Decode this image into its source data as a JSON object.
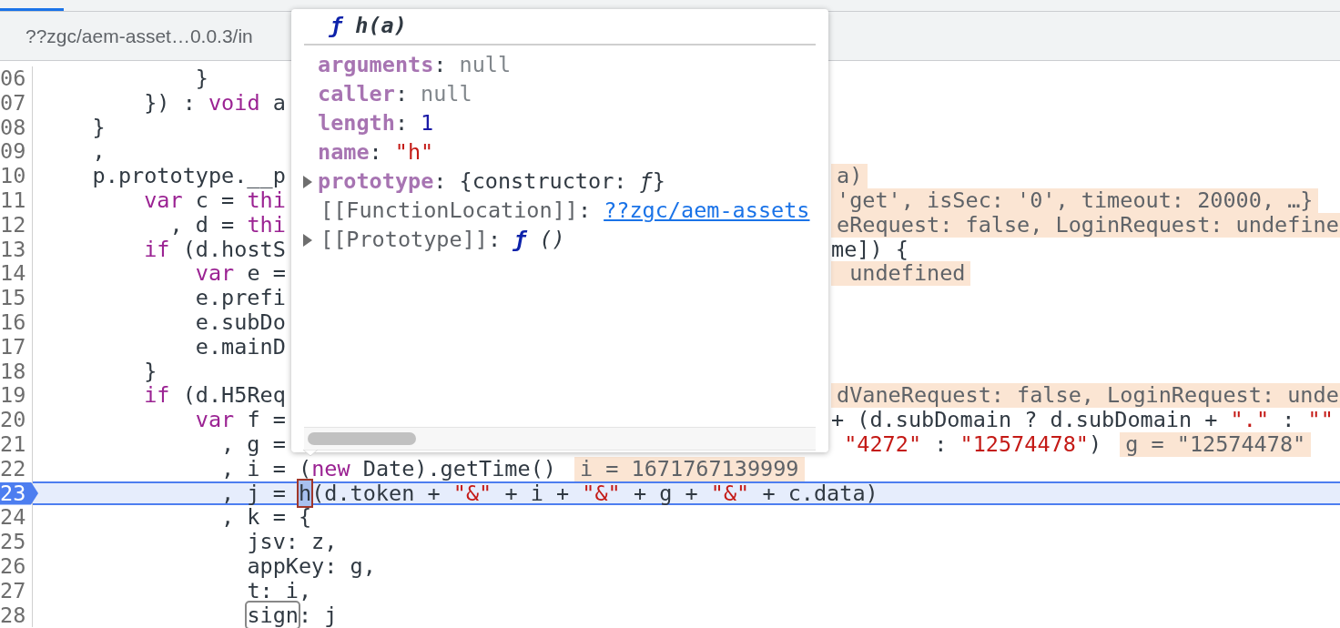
{
  "file_tab": {
    "label": "??zgc/aem-asset…0.0.3/in"
  },
  "lines": [
    {
      "number": "06",
      "current": false,
      "left": [
        {
          "text": "            }",
          "kind": "plain"
        }
      ]
    },
    {
      "number": "07",
      "current": false,
      "left": [
        {
          "text": "        }) : ",
          "kind": "plain"
        },
        {
          "text": "void",
          "kind": "keyword"
        },
        {
          "text": " a",
          "kind": "plain"
        }
      ]
    },
    {
      "number": "08",
      "current": false,
      "left": [
        {
          "text": "    }",
          "kind": "plain"
        }
      ]
    },
    {
      "number": "09",
      "current": false,
      "left": [
        {
          "text": "    ,",
          "kind": "plain"
        }
      ]
    },
    {
      "number": "10",
      "current": false,
      "left": [
        {
          "text": "    p.prototype.__p",
          "kind": "plain"
        }
      ],
      "right": [
        {
          "text": "a)",
          "kind": "value"
        }
      ]
    },
    {
      "number": "11",
      "current": false,
      "left": [
        {
          "text": "        var",
          "kind": "keyword"
        },
        {
          "text": " c = ",
          "kind": "plain"
        },
        {
          "text": "thi",
          "kind": "keyword"
        }
      ],
      "right": [
        {
          "text": "'get', isSec: '0', timeout: 20000, …}",
          "kind": "value"
        }
      ]
    },
    {
      "number": "12",
      "current": false,
      "left": [
        {
          "text": "          , d = ",
          "kind": "plain"
        },
        {
          "text": "thi",
          "kind": "keyword"
        }
      ],
      "right": [
        {
          "text": "eRequest: false, LoginRequest: undefine",
          "kind": "value"
        }
      ]
    },
    {
      "number": "13",
      "current": false,
      "left": [
        {
          "text": "        if",
          "kind": "keyword"
        },
        {
          "text": " (d.hostS",
          "kind": "plain"
        }
      ],
      "right": [
        {
          "text": "me]) {",
          "kind": "plain"
        }
      ]
    },
    {
      "number": "14",
      "current": false,
      "left": [
        {
          "text": "            var",
          "kind": "keyword"
        },
        {
          "text": " e =",
          "kind": "plain"
        }
      ],
      "right": [
        {
          "text": " undefined",
          "kind": "value"
        }
      ]
    },
    {
      "number": "15",
      "current": false,
      "left": [
        {
          "text": "            e.prefi",
          "kind": "plain"
        }
      ]
    },
    {
      "number": "16",
      "current": false,
      "left": [
        {
          "text": "            e.subDo",
          "kind": "plain"
        }
      ]
    },
    {
      "number": "17",
      "current": false,
      "left": [
        {
          "text": "            e.mainD",
          "kind": "plain"
        }
      ]
    },
    {
      "number": "18",
      "current": false,
      "left": [
        {
          "text": "        }",
          "kind": "plain"
        }
      ]
    },
    {
      "number": "19",
      "current": false,
      "left": [
        {
          "text": "        if",
          "kind": "keyword"
        },
        {
          "text": " (d.H5Req",
          "kind": "plain"
        }
      ],
      "right": [
        {
          "text": "dVaneRequest: false, LoginRequest: unde",
          "kind": "value"
        }
      ]
    },
    {
      "number": "20",
      "current": false,
      "left": [
        {
          "text": "            var",
          "kind": "keyword"
        },
        {
          "text": " f =",
          "kind": "plain"
        }
      ],
      "right": [
        {
          "text": "+ (d.subDomain ? d.subDomain + ",
          "kind": "plain"
        },
        {
          "text": "\".\"",
          "kind": "string"
        },
        {
          "text": " : ",
          "kind": "plain"
        },
        {
          "text": "\"\"",
          "kind": "string"
        }
      ]
    },
    {
      "number": "21",
      "current": false,
      "left": [
        {
          "text": "              , g =",
          "kind": "plain"
        }
      ],
      "right": [
        {
          "text": " \"4272\"",
          "kind": "string"
        },
        {
          "text": " : ",
          "kind": "plain"
        },
        {
          "text": "\"12574478\"",
          "kind": "string"
        },
        {
          "text": ")",
          "kind": "plain"
        },
        {
          "text": "g = \"12574478\"",
          "kind": "value"
        }
      ]
    },
    {
      "number": "22",
      "current": false,
      "left": [
        {
          "text": "              , i = (",
          "kind": "plain"
        },
        {
          "text": "new",
          "kind": "keyword"
        },
        {
          "text": " Date).getTime()",
          "kind": "plain"
        },
        {
          "text": "i = 1671767139999",
          "kind": "value"
        }
      ]
    },
    {
      "number": "23",
      "current": true,
      "left": [
        {
          "text": "              , j = ",
          "kind": "plain"
        },
        {
          "text": "h",
          "kind": "hover"
        },
        {
          "text": "(d.token + ",
          "kind": "plain"
        },
        {
          "text": "\"&\"",
          "kind": "string"
        },
        {
          "text": " + i + ",
          "kind": "plain"
        },
        {
          "text": "\"&\"",
          "kind": "string"
        },
        {
          "text": " + g + ",
          "kind": "plain"
        },
        {
          "text": "\"&\"",
          "kind": "string"
        },
        {
          "text": " + c.data)",
          "kind": "plain"
        }
      ]
    },
    {
      "number": "24",
      "current": false,
      "left": [
        {
          "text": "              , k = {",
          "kind": "plain"
        }
      ]
    },
    {
      "number": "25",
      "current": false,
      "left": [
        {
          "text": "                jsv: z,",
          "kind": "plain"
        }
      ]
    },
    {
      "number": "26",
      "current": false,
      "left": [
        {
          "text": "                appKey: g,",
          "kind": "plain"
        }
      ]
    },
    {
      "number": "27",
      "current": false,
      "left": [
        {
          "text": "                t: i,",
          "kind": "plain"
        }
      ]
    },
    {
      "number": "28",
      "current": false,
      "left": [
        {
          "text": "                sign",
          "kind": "boxed"
        },
        {
          "text": ": j",
          "kind": "plain"
        }
      ]
    }
  ],
  "popover": {
    "title": [
      {
        "text": "ƒ",
        "kind": "function"
      },
      {
        "text": " h(a)",
        "kind": "signature"
      }
    ],
    "properties": [
      {
        "key": "arguments",
        "separator": ":",
        "internal": false,
        "expandable": false,
        "value": [
          {
            "text": "null",
            "kind": "null"
          }
        ]
      },
      {
        "key": "caller",
        "separator": ":",
        "internal": false,
        "expandable": false,
        "value": [
          {
            "text": "null",
            "kind": "null"
          }
        ]
      },
      {
        "key": "length",
        "separator": ":",
        "internal": false,
        "expandable": false,
        "value": [
          {
            "text": "1",
            "kind": "number"
          }
        ]
      },
      {
        "key": "name",
        "separator": ":",
        "internal": false,
        "expandable": false,
        "value": [
          {
            "text": "\"h\"",
            "kind": "string"
          }
        ]
      },
      {
        "key": "prototype",
        "separator": ":",
        "internal": false,
        "expandable": true,
        "value": [
          {
            "text": "{constructor: ",
            "kind": "plain"
          },
          {
            "text": "ƒ",
            "kind": "italic"
          },
          {
            "text": "}",
            "kind": "plain"
          }
        ]
      },
      {
        "key": "[[FunctionLocation]]",
        "separator": ":",
        "internal": true,
        "expandable": false,
        "value": [
          {
            "text": "??zgc/aem-assets",
            "kind": "link"
          }
        ]
      },
      {
        "key": "[[Prototype]]",
        "separator": ":",
        "internal": true,
        "expandable": true,
        "value": [
          {
            "text": "ƒ",
            "kind": "function"
          },
          {
            "text": " ()",
            "kind": "italic"
          }
        ]
      }
    ]
  }
}
